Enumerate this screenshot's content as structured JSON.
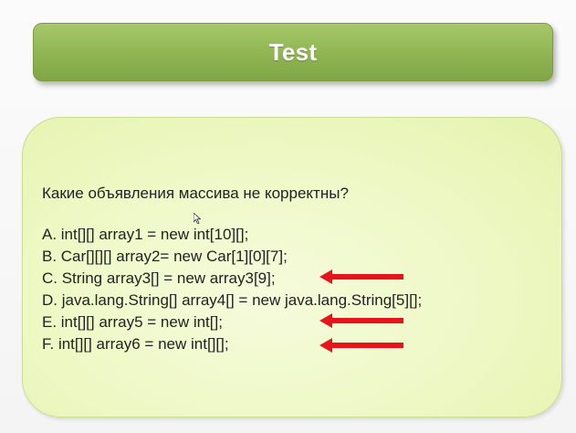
{
  "slide": {
    "title": "Test",
    "question": "Какие объявления массива не корректны?",
    "options": [
      {
        "label": "A. int[][] array1 = new int[10][];",
        "marked": false
      },
      {
        "label": "B. Car[][][] array2= new Car[1][0][7];",
        "marked": false
      },
      {
        "label": "C. String array3[] = new array3[9];",
        "marked": true
      },
      {
        "label": "D. java.lang.String[] array4[] = new java.lang.String[5][];",
        "marked": false
      },
      {
        "label": "E. int[][] array5 = new int[];",
        "marked": true
      },
      {
        "label": "F. int[][] array6 = new int[][];",
        "marked": true
      }
    ],
    "colors": {
      "title_bar": "#93b856",
      "content_box": "#eef8c4",
      "arrow": "#e8141b"
    },
    "icons": {
      "marker": "left-arrow-icon",
      "pointer": "mouse-cursor-icon"
    }
  }
}
